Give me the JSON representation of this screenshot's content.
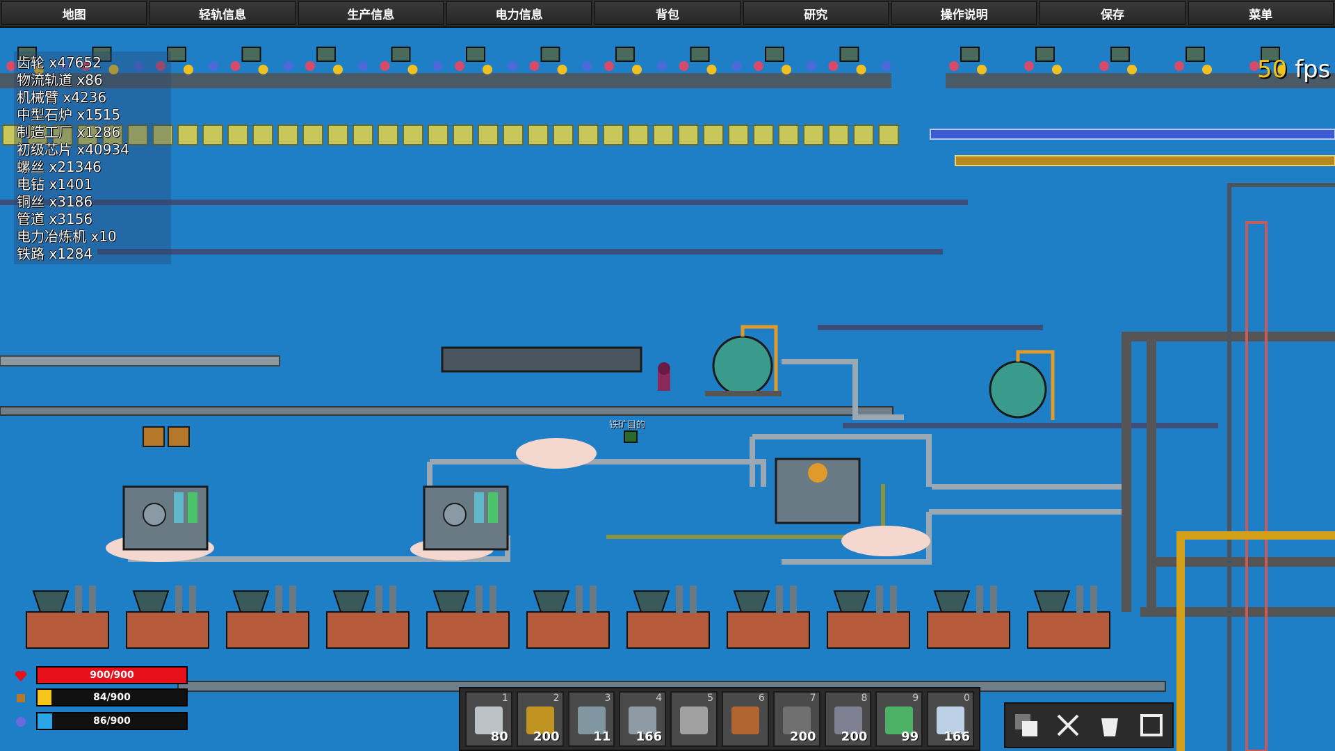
{
  "menu": [
    {
      "label": "地图"
    },
    {
      "label": "轻轨信息"
    },
    {
      "label": "生产信息"
    },
    {
      "label": "电力信息"
    },
    {
      "label": "背包"
    },
    {
      "label": "研究"
    },
    {
      "label": "操作说明"
    },
    {
      "label": "保存"
    },
    {
      "label": "菜单"
    }
  ],
  "inventory": [
    "齿轮 x47652",
    "物流轨道 x86",
    "机械臂 x4236",
    "中型石炉 x1515",
    "制造工厂 x1286",
    "初级芯片 x40934",
    "螺丝 x21346",
    "电钻 x1401",
    "铜丝 x3186",
    "管道 x3156",
    "电力冶炼机 x10",
    "铁路 x1284"
  ],
  "fps": {
    "value": "50",
    "unit": " fps"
  },
  "stats": {
    "health": {
      "text": "900/900",
      "fraction": 1.0,
      "color": "#e8101a"
    },
    "hunger": {
      "text": "84/900",
      "fraction": 0.093,
      "color": "#f5c518"
    },
    "energy": {
      "text": "86/900",
      "fraction": 0.096,
      "color": "#2aa6e8"
    }
  },
  "hotbar": [
    {
      "key": "1",
      "count": "80",
      "icon": "crosshair-icon"
    },
    {
      "key": "2",
      "count": "200",
      "icon": "robot-arm-icon"
    },
    {
      "key": "3",
      "count": "11",
      "icon": "factory-icon"
    },
    {
      "key": "4",
      "count": "166",
      "icon": "pipe-cross-icon"
    },
    {
      "key": "5",
      "count": "",
      "icon": "drill-icon"
    },
    {
      "key": "6",
      "count": "",
      "icon": "hammer-icon"
    },
    {
      "key": "7",
      "count": "200",
      "icon": "rail-icon"
    },
    {
      "key": "8",
      "count": "200",
      "icon": "ore-icon"
    },
    {
      "key": "9",
      "count": "99",
      "icon": "conveyor-icon"
    },
    {
      "key": "0",
      "count": "166",
      "icon": "bottle-icon"
    }
  ],
  "world": {
    "label_ore": "铁矿目的"
  },
  "colors": {
    "sky": "#1e7fc6",
    "pipe": "#7b8a96",
    "chain": "#555555",
    "ladder": "#c85a5a",
    "gold_pipe": "#d4a017"
  }
}
